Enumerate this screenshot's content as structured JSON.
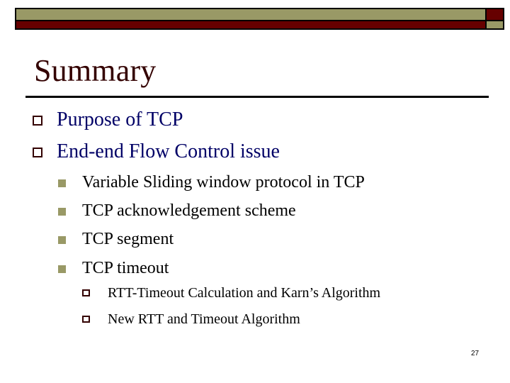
{
  "slide": {
    "title": "Summary",
    "page_number": "27",
    "colors": {
      "olive": "#999966",
      "maroon": "#660000",
      "title_text": "#330000",
      "level1_text": "#000066",
      "level2_text": "#000000",
      "level3_text": "#000000",
      "level1_bullet": "#330000",
      "level2_bullet": "#999966",
      "level3_bullet": "#330000"
    },
    "bullets": [
      {
        "level": 1,
        "icon": "hollow-square",
        "text": "Purpose of TCP"
      },
      {
        "level": 1,
        "icon": "hollow-square",
        "text": "End-end Flow Control issue"
      },
      {
        "level": 2,
        "icon": "filled-square",
        "text": "Variable Sliding window protocol in TCP"
      },
      {
        "level": 2,
        "icon": "filled-square",
        "text": "TCP acknowledgement scheme"
      },
      {
        "level": 2,
        "icon": "filled-square",
        "text": "TCP segment"
      },
      {
        "level": 2,
        "icon": "filled-square",
        "text": "TCP timeout"
      },
      {
        "level": 3,
        "icon": "hollow-square",
        "text": "RTT-Timeout Calculation and Karn’s Algorithm"
      },
      {
        "level": 3,
        "icon": "hollow-square",
        "text": "New RTT and Timeout Algorithm"
      }
    ]
  }
}
